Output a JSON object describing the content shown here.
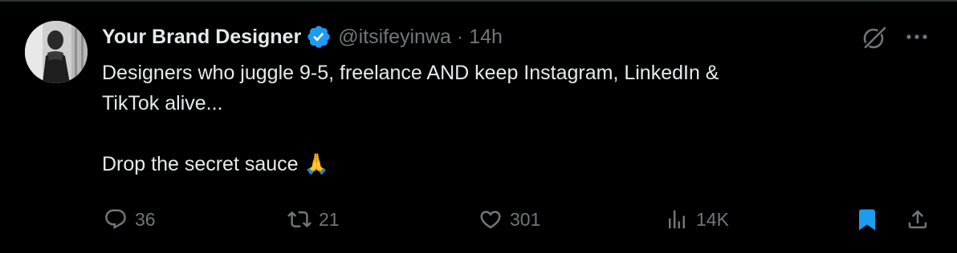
{
  "tweet": {
    "author_name": "Your Brand Designer",
    "handle": "@itsifeyinwa",
    "separator": "·",
    "time": "14h",
    "text_line1": "Designers who juggle 9-5, freelance AND keep Instagram, LinkedIn &",
    "text_line2": "TikTok alive...",
    "text_line3": "Drop the secret sauce 🙏",
    "verified": true
  },
  "actions": {
    "replies": "36",
    "reposts": "21",
    "likes": "301",
    "views": "14K",
    "bookmarked": true
  },
  "colors": {
    "background": "#000000",
    "text": "#e7e9ea",
    "secondary": "#71767b",
    "verified_blue": "#1d9bf0",
    "bookmark_blue": "#1d9bf0"
  },
  "icons": [
    "verified-badge-icon",
    "grok-icon",
    "more-icon",
    "reply-icon",
    "repost-icon",
    "like-icon",
    "views-icon",
    "bookmark-icon",
    "share-icon"
  ]
}
